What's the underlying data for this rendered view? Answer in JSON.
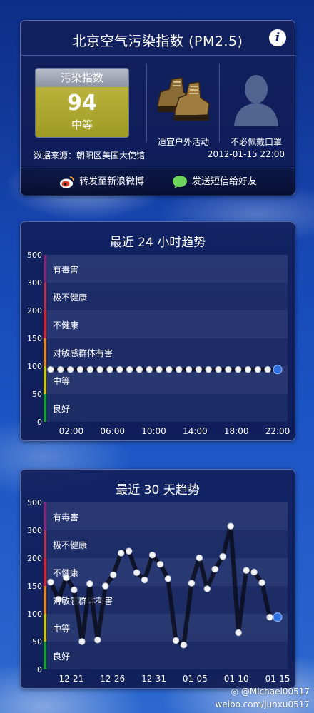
{
  "header": {
    "title": "北京空气污染指数 (PM2.5)",
    "info_icon": "info-icon"
  },
  "current": {
    "label": "污染指数",
    "value": "94",
    "level": "中等",
    "level_color": "#aaa62e"
  },
  "activities": [
    {
      "icon": "hiking-boots-icon",
      "label": "适宜户外活动"
    },
    {
      "icon": "person-silhouette-icon",
      "label": "不必佩戴口罩"
    }
  ],
  "source": "数据来源：朝阳区美国大使馆",
  "timestamp": "2012-01-15 22:00",
  "share": {
    "weibo": "转发至新浪微博",
    "sms": "发送短信给好友"
  },
  "bands": [
    {
      "from": 300,
      "to": 500,
      "label": "有毒害",
      "color": "#7b2a7a"
    },
    {
      "from": 200,
      "to": 300,
      "label": "极不健康",
      "color": "#a33a5c"
    },
    {
      "from": 150,
      "to": 200,
      "label": "不健康",
      "color": "#c8283a"
    },
    {
      "from": 100,
      "to": 150,
      "label": "对敏感群体有害",
      "color": "#e0862a"
    },
    {
      "from": 50,
      "to": 100,
      "label": "中等",
      "color": "#c9c41e"
    },
    {
      "from": 0,
      "to": 50,
      "label": "良好",
      "color": "#1f9a3a"
    }
  ],
  "chart_data": [
    {
      "type": "line",
      "title": "最近 24 小时趋势",
      "y_ticks": [
        "500",
        "300",
        "200",
        "150",
        "100",
        "50",
        "0"
      ],
      "x_ticks": [
        "02:00",
        "06:00",
        "10:00",
        "14:00",
        "18:00",
        "22:00"
      ],
      "values": [
        94,
        94,
        94,
        94,
        94,
        94,
        94,
        94,
        94,
        94,
        94,
        94,
        94,
        94,
        94,
        94,
        94,
        94,
        94,
        94,
        94,
        94,
        94,
        94
      ],
      "current_color": "#2f6fe0"
    },
    {
      "type": "line",
      "title": "最近 30 天趋势",
      "y_ticks": [
        "500",
        "300",
        "200",
        "150",
        "100",
        "50",
        "0"
      ],
      "x_ticks": [
        "12-21",
        "12-26",
        "12-31",
        "01-05",
        "01-10",
        "01-15"
      ],
      "values": [
        157,
        126,
        165,
        143,
        50,
        154,
        53,
        150,
        170,
        218,
        225,
        174,
        161,
        211,
        189,
        163,
        52,
        44,
        155,
        201,
        145,
        180,
        206,
        330,
        66,
        178,
        175,
        156,
        94,
        94
      ],
      "current_color": "#2f6fe0"
    }
  ],
  "watermark": {
    "handle": "@Michael00517",
    "url": "weibo.com/junxu0517"
  }
}
